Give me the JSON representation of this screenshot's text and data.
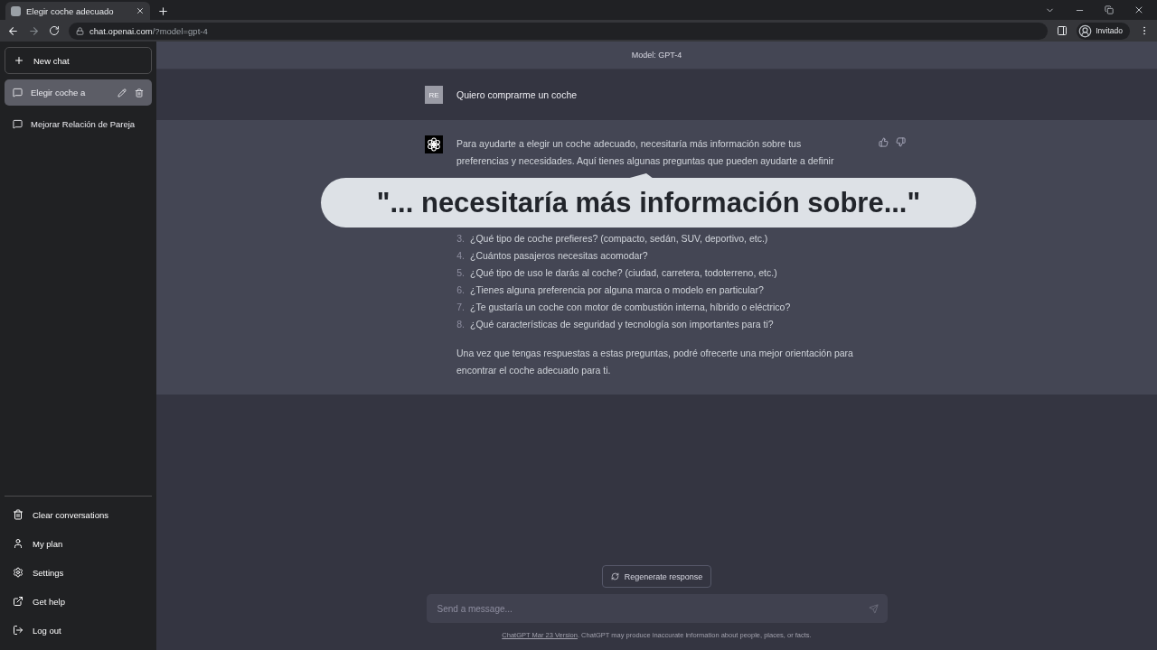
{
  "browser": {
    "tab_title": "Elegir coche adecuado",
    "address_host": "chat.openai.com",
    "address_path": "/?model=gpt-4",
    "profile": "Invitado"
  },
  "sidebar": {
    "new_chat": "New chat",
    "conversations": [
      {
        "title": "Elegir coche a",
        "selected": true
      },
      {
        "title": "Mejorar Relación de Pareja",
        "selected": false
      }
    ],
    "footer_items": [
      {
        "label": "Clear conversations",
        "kind": "trash"
      },
      {
        "label": "My plan",
        "kind": "user"
      },
      {
        "label": "Settings",
        "kind": "settings"
      },
      {
        "label": "Get help",
        "kind": "external"
      },
      {
        "label": "Log out",
        "kind": "logout"
      }
    ]
  },
  "model_label": "Model: GPT-4",
  "user_message": {
    "avatar": "RE",
    "text": "Quiero comprarme un coche"
  },
  "assistant_message": {
    "intro": "Para ayudarte a elegir un coche adecuado, necesitaría más información sobre tus preferencias y necesidades. Aquí tienes algunas preguntas que pueden ayudarte a definir",
    "items": [
      {
        "number": "3.",
        "text": "¿Qué tipo de coche prefieres? (compacto, sedán, SUV, deportivo, etc.)"
      },
      {
        "number": "4.",
        "text": "¿Cuántos pasajeros necesitas acomodar?"
      },
      {
        "number": "5.",
        "text": "¿Qué tipo de uso le darás al coche? (ciudad, carretera, todoterreno, etc.)"
      },
      {
        "number": "6.",
        "text": "¿Tienes alguna preferencia por alguna marca o modelo en particular?"
      },
      {
        "number": "7.",
        "text": "¿Te gustaría un coche con motor de combustión interna, híbrido o eléctrico?"
      },
      {
        "number": "8.",
        "text": "¿Qué características de seguridad y tecnología son importantes para ti?"
      }
    ],
    "outro": "Una vez que tengas respuestas a estas preguntas, podré ofrecerte una mejor orientación para encontrar el coche adecuado para ti."
  },
  "callout": "\"... necesitaría más información sobre...\"",
  "regenerate": "Regenerate response",
  "composer": {
    "placeholder": "Send a message..."
  },
  "disclaimer": {
    "link": "ChatGPT Mar 23 Version",
    "text": ". ChatGPT may produce inaccurate information about people, places, or facts."
  }
}
